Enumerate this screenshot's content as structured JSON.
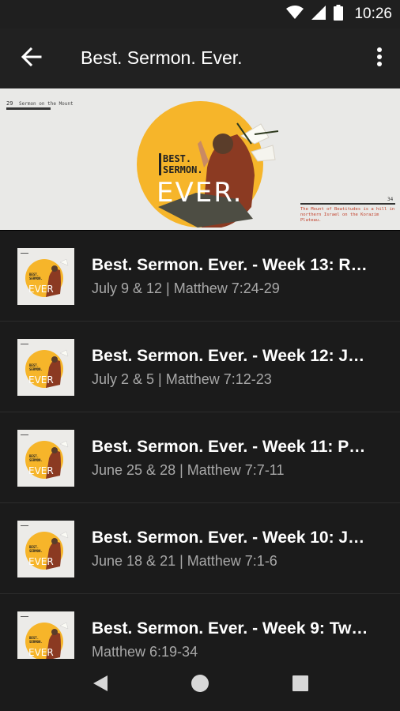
{
  "status_bar": {
    "time": "10:26",
    "icons": [
      "wifi-icon",
      "signal-icon",
      "battery-icon"
    ]
  },
  "app_bar": {
    "title": "Best. Sermon. Ever.",
    "back_icon": "arrow-left-icon",
    "menu_icon": "more-vertical-icon"
  },
  "banner": {
    "series_label": "Sermon on the Mount",
    "series_number": "29",
    "logo_line1": "BEST.",
    "logo_line2": "SERMON.",
    "logo_line3": "EVER.",
    "page_number": "34",
    "caption": "The Mount of Beatitudes is a hill in northern Israel on the Korazim Plateau."
  },
  "sermons": [
    {
      "title": "Best. Sermon. Ever. - Week 13: R…",
      "subtitle": "July 9 & 12 | Matthew 7:24-29"
    },
    {
      "title": "Best. Sermon. Ever. - Week 12: J…",
      "subtitle": "July 2 & 5 | Matthew 7:12-23"
    },
    {
      "title": "Best. Sermon. Ever. - Week 11: P…",
      "subtitle": "June 25 & 28 | Matthew 7:7-11"
    },
    {
      "title": "Best. Sermon. Ever. - Week 10: J…",
      "subtitle": "June 18 & 21 | Matthew 7:1-6"
    },
    {
      "title": "Best. Sermon. Ever. - Week 9: Tw…",
      "subtitle": "Matthew 6:19-34"
    }
  ],
  "thumbnail": {
    "logo_line1": "BEST.",
    "logo_line2": "SERMON.",
    "logo_line3": "EVER"
  },
  "nav_bar": {
    "buttons": [
      "back-triangle-icon",
      "home-circle-icon",
      "recents-square-icon"
    ]
  },
  "colors": {
    "background": "#1b1b1b",
    "app_bar": "#212121",
    "accent_yellow": "#f6b52a",
    "subtitle_gray": "#a8a8a8"
  }
}
